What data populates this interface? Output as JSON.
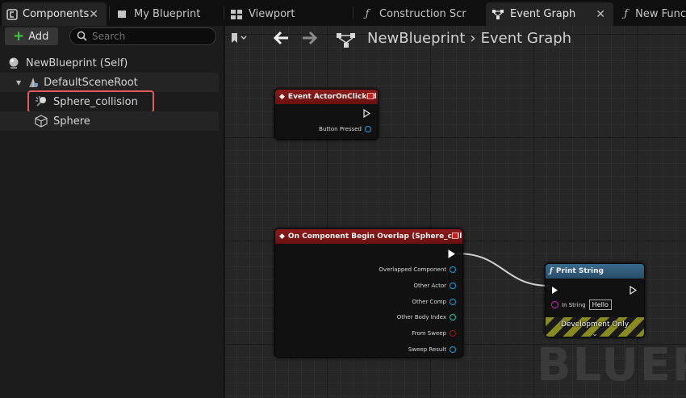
{
  "tabs": [
    {
      "label": "Components",
      "icon": "components-icon",
      "closable": true
    },
    {
      "label": "My Blueprint",
      "icon": "book-icon",
      "closable": false
    },
    {
      "label": "Viewport",
      "icon": "viewport-icon",
      "closable": false
    },
    {
      "label": "Construction Scr",
      "icon": "function-icon",
      "closable": false
    },
    {
      "label": "Event Graph",
      "icon": "graph-icon",
      "closable": true
    },
    {
      "label": "New Func",
      "icon": "function-icon",
      "closable": false
    }
  ],
  "components": {
    "add_label": "Add",
    "search_placeholder": "Search",
    "tree": [
      {
        "label": "NewBlueprint (Self)",
        "icon": "self-icon"
      },
      {
        "label": "DefaultSceneRoot",
        "icon": "scene-root-icon"
      },
      {
        "label": "Sphere_collision",
        "icon": "collision-icon"
      },
      {
        "label": "Sphere",
        "icon": "mesh-icon"
      }
    ]
  },
  "graph": {
    "breadcrumb_root": "NewBlueprint",
    "breadcrumb_current": "Event Graph",
    "watermark": "BLUEPR",
    "nodes": {
      "actor_clicked": {
        "title": "Event ActorOnClicked",
        "pins": [
          "Button Pressed"
        ]
      },
      "begin_overlap": {
        "title": "On Component Begin Overlap (Sphere_collision)",
        "pins": [
          "Overlapped Component",
          "Other Actor",
          "Other Comp",
          "Other Body Index",
          "From Sweep",
          "Sweep Result"
        ]
      },
      "print_string": {
        "title": "Print String",
        "in_string_label": "In String",
        "in_string_value": "Hello",
        "footer": "Development Only"
      }
    }
  },
  "colors": {
    "accent_highlight": "#e35a5a",
    "event_header": "#7a1616",
    "function_header": "#2f5a78",
    "object_pin": "#1aa3e8",
    "int_pin": "#1ad0b0",
    "bool_pin": "#a01515",
    "string_pin": "#e020c0"
  }
}
